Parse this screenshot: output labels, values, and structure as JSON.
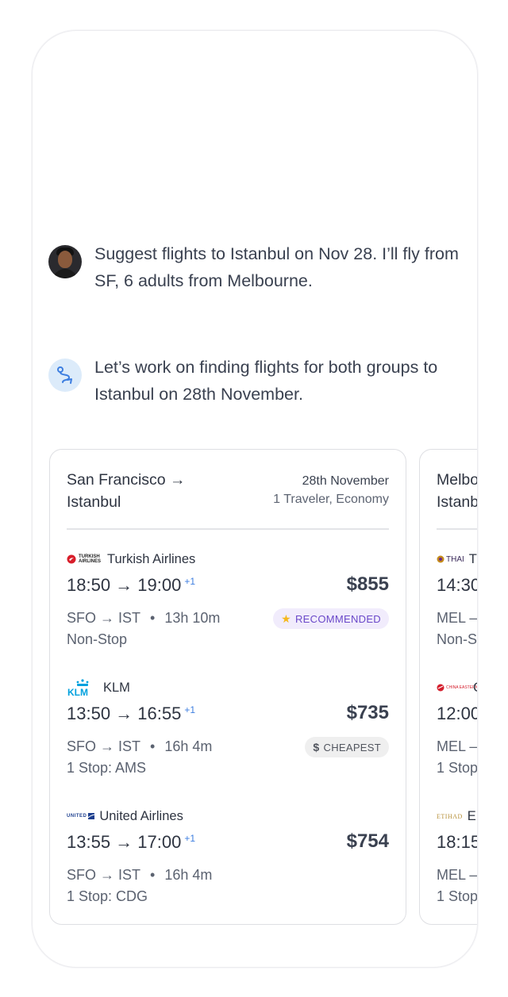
{
  "conversation": {
    "user_message": "Suggest flights to Istanbul on Nov 28. I’ll fly from SF, 6 adults from Melbourne.",
    "assistant_message": "Let’s work on finding flights for both groups to Istanbul on 28th November."
  },
  "card1": {
    "route_line1": "San Francisco →",
    "route_line2": "Istanbul",
    "date": "28th November",
    "travelers": "1 Traveler, Economy",
    "flights": [
      {
        "airline": "Turkish Airlines",
        "logo_text": "TURKISH AIRLINES",
        "times": "18:50 → 19:00",
        "day_offset": "+1",
        "price": "$855",
        "route": "SFO → IST",
        "duration": "13h 10m",
        "stops": "Non-Stop",
        "badge": "RECOMMENDED",
        "badge_icon": "star-icon"
      },
      {
        "airline": "KLM",
        "logo_text": "KLM",
        "times": "13:50 → 16:55",
        "day_offset": "+1",
        "price": "$735",
        "route": "SFO → IST",
        "duration": "16h 4m",
        "stops": "1 Stop:  AMS",
        "badge": "CHEAPEST",
        "badge_icon": "dollar-icon"
      },
      {
        "airline": "United Airlines",
        "logo_text": "UNITED",
        "times": "13:55 → 17:00",
        "day_offset": "+1",
        "price": "$754",
        "route": "SFO → IST",
        "duration": "16h 4m",
        "stops": "1 Stop:  CDG"
      }
    ]
  },
  "card2": {
    "route_line1": "Melbo",
    "route_line2": "Istanb",
    "flights": [
      {
        "logo_text": "THAI",
        "airline": "T",
        "times": "14:30",
        "route": "MEL –",
        "stops": "Non-S"
      },
      {
        "logo_text": "CHINA EASTERN",
        "airline": "C",
        "times": "12:00",
        "route": "MEL –",
        "stops": "1 Stop"
      },
      {
        "logo_text": "ETIHAD",
        "airline": "E",
        "times": "18:15",
        "route": "MEL –",
        "stops": "1 Stop"
      }
    ]
  },
  "colors": {
    "accent_blue": "#3d7ee0",
    "recommended_bg": "#f1ecfc",
    "recommended_text": "#6a48c9",
    "cheapest_bg": "#efefef",
    "star": "#f5b81c",
    "turkish_red": "#d81e2a",
    "klm_blue": "#00a1de",
    "united_blue": "#1d3f8f"
  }
}
